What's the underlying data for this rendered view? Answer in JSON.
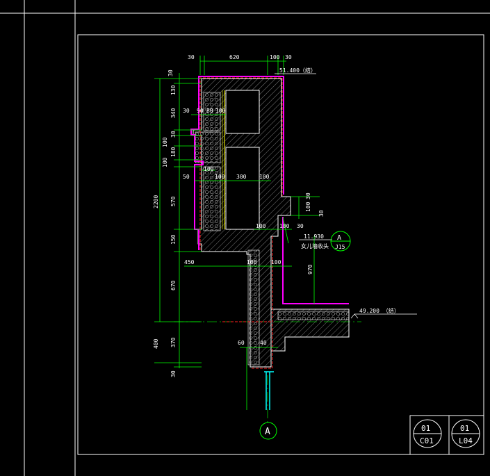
{
  "colors": {
    "background": "#000000",
    "frame": "#ffffff",
    "dimension": "#00ff00",
    "concrete_outline": "#ffffff",
    "insulation_outline": "#ff00ff",
    "finish_line": "#ff0000",
    "frame_yellow": "#ffff00",
    "grid_axis": "#00ff00",
    "window": "#00ffff"
  },
  "top_dims": {
    "d30a": "30",
    "d620": "620",
    "d100": "100",
    "d30b": "30"
  },
  "elevation_top": "51.400（结）",
  "elevation_mid": "11.930",
  "elevation_low": "49.200 （结）",
  "note_parapet": "女儿墙收头",
  "left_dims": {
    "d30": "30",
    "d130": "130",
    "d340": "340",
    "d30b": "30",
    "d100": "100",
    "d180": "180",
    "d100b": "100",
    "d2200": "2200",
    "d570": "570",
    "d150": "150",
    "d670": "670",
    "d400": "400",
    "d370": "370",
    "d30c": "30"
  },
  "inner_dims": {
    "d30": "30",
    "d90": "90",
    "d80": "80",
    "d100": "100",
    "d100b": "100",
    "d50": "50",
    "d100c": "100",
    "d300": "300",
    "d100d": "100",
    "d100e": "100",
    "d100f": "100",
    "d30b": "30",
    "d450": "450",
    "d100g": "100",
    "d100h": "100",
    "d60": "60",
    "d40": "40",
    "d100r": "100",
    "d30r": "30",
    "d970": "970",
    "d30rr": "30"
  },
  "detail_callout": {
    "letter": "A",
    "sheet": "J15"
  },
  "grid_axis": {
    "label": "A"
  },
  "title_blocks": [
    {
      "number": "01",
      "sheet": "C01"
    },
    {
      "number": "01",
      "sheet": "L04"
    }
  ]
}
